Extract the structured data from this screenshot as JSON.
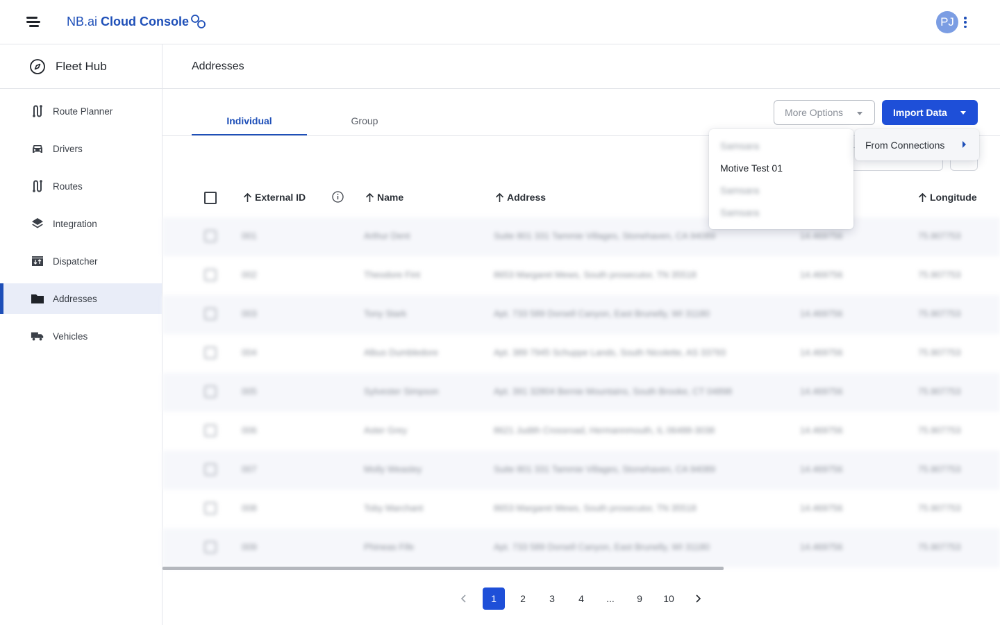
{
  "header": {
    "brand_prefix": "NB.ai",
    "brand_name": "Cloud Console",
    "avatar_initials": "PJ"
  },
  "sidebar": {
    "hub_label": "Fleet Hub",
    "items": [
      {
        "label": "Route Planner",
        "icon": "route-icon"
      },
      {
        "label": "Drivers",
        "icon": "car-icon"
      },
      {
        "label": "Routes",
        "icon": "route-icon"
      },
      {
        "label": "Integration",
        "icon": "layers-icon"
      },
      {
        "label": "Dispatcher",
        "icon": "dispatch-icon"
      },
      {
        "label": "Addresses",
        "icon": "folder-icon",
        "active": true
      },
      {
        "label": "Vehicles",
        "icon": "truck-icon"
      }
    ]
  },
  "page": {
    "title": "Addresses",
    "tabs": [
      "Individual",
      "Group"
    ],
    "more_options_label": "More Options",
    "import_label": "Import Data"
  },
  "import_menu": {
    "items": [
      "Samsara",
      "Motive Test 01",
      "Samsara",
      "Samsara"
    ],
    "submenu_label": "From Connections"
  },
  "table": {
    "columns": [
      "External ID",
      "Name",
      "Address",
      "Longitude"
    ],
    "rows": [
      {
        "id": "001",
        "name": "Arthur Dent",
        "address": "Suite 801 331 Tammie Villages, Stonehaven, CA 94089",
        "lat": "14.469756",
        "lng": "75.907753"
      },
      {
        "id": "002",
        "name": "Theodore Fint",
        "address": "8653 Margaret Mews, South prosecutor, TN 35518",
        "lat": "14.469756",
        "lng": "75.907753"
      },
      {
        "id": "003",
        "name": "Tony Stark",
        "address": "Apt. 733 589 Dorsell Canyon, East Brunelly, WI 31180",
        "lat": "14.469756",
        "lng": "75.907753"
      },
      {
        "id": "004",
        "name": "Albus Dumbledore",
        "address": "Apt. 389 7945 Schuppe Lands, South Nicolette, AS 33793",
        "lat": "14.469756",
        "lng": "75.907753"
      },
      {
        "id": "005",
        "name": "Sylvester Simpson",
        "address": "Apt. 391 32804 Bernie Mountains, South Brooke, CT 04898",
        "lat": "14.469756",
        "lng": "75.907753"
      },
      {
        "id": "006",
        "name": "Aster Grey",
        "address": "8621 Judith Crossroad, Hermannmouth, IL 06488-3038",
        "lat": "14.469756",
        "lng": "75.907753"
      },
      {
        "id": "007",
        "name": "Molly Weasley",
        "address": "Suite 801 331 Tammie Villages, Stonehaven, CA 94089",
        "lat": "14.469756",
        "lng": "75.907753"
      },
      {
        "id": "008",
        "name": "Toby Marchant",
        "address": "8653 Margaret Mews, South prosecutor, TN 35518",
        "lat": "14.469756",
        "lng": "75.907753"
      },
      {
        "id": "009",
        "name": "Phineas Fife",
        "address": "Apt. 733 589 Dorsell Canyon, East Brunelly, WI 31180",
        "lat": "14.469756",
        "lng": "75.907753"
      }
    ]
  },
  "pagination": {
    "pages": [
      "1",
      "2",
      "3",
      "4",
      "...",
      "9",
      "10"
    ],
    "current": "1"
  },
  "colors": {
    "accent": "#1e4fd8",
    "brand": "#1e4fb8",
    "active_nav_bg": "#e9edf8"
  }
}
